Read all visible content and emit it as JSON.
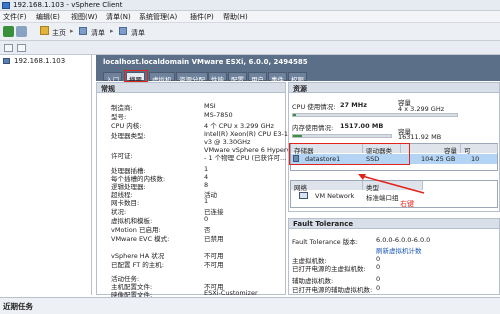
{
  "window": {
    "title": "192.168.1.103 - vSphere Client"
  },
  "menu": [
    "文件(F)",
    "编辑(E)",
    "视图(W)",
    "清单(N)",
    "系统管理(A)",
    "插件(P)",
    "帮助(H)"
  ],
  "nav": {
    "home": "主页",
    "inventory1": "清单",
    "inventory2": "清单"
  },
  "tree": {
    "host": "192.168.1.103"
  },
  "host": {
    "title": "localhost.localdomain VMware ESXi, 6.0.0, 2494585"
  },
  "tabs": [
    "入门",
    "摘要",
    "虚拟机",
    "资源分配",
    "性能",
    "配置",
    "用户",
    "事件",
    "权限"
  ],
  "general": {
    "header": "常规",
    "rows": [
      {
        "label": "制造商:",
        "value": "MSI"
      },
      {
        "label": "型号:",
        "value": "MS-7850"
      },
      {
        "label": "CPU 内核:",
        "value": "4 个 CPU x 3.299 GHz"
      },
      {
        "label": "处理器类型:",
        "value": "Intel(R) Xeon(R) CPU E3-1230\nv3 @ 3.30GHz"
      },
      {
        "label": "许可证:",
        "value": "VMware vSphere 6 Hypervisor\n- 1 个物理 CPU (已获许可..."
      },
      {
        "label": "处理器插槽:",
        "value": "1"
      },
      {
        "label": "每个插槽的内核数:",
        "value": "4"
      },
      {
        "label": "逻辑处理器:",
        "value": "8"
      },
      {
        "label": "超线程:",
        "value": "活动"
      },
      {
        "label": "网卡数目:",
        "value": "1"
      },
      {
        "label": "状况:",
        "value": "已连接"
      },
      {
        "label": "虚拟机和模板:",
        "value": "0"
      },
      {
        "label": "vMotion 已启用:",
        "value": "否"
      },
      {
        "label": "VMware EVC 模式:",
        "value": "已禁用"
      },
      {
        "label": "vSphere HA 状况",
        "value": "不可用"
      },
      {
        "label": "已配置 FT 的主机:",
        "value": "不可用"
      },
      {
        "label": "活动任务:",
        "value": ""
      },
      {
        "label": "主机配置文件:",
        "value": "不可用"
      },
      {
        "label": "映像配置文件:",
        "value": "ESXi-Customizer"
      }
    ]
  },
  "resources": {
    "header": "资源",
    "cpu_label": "CPU 使用情况:",
    "cpu_value": "27 MHz",
    "cpu_cap_label": "容量",
    "cpu_cap": "4 x 3.299 GHz",
    "cpu_usage_fraction": 0.02,
    "mem_label": "内存使用情况:",
    "mem_value": "1517.00 MB",
    "mem_cap_label": "容量",
    "mem_cap": "16311.92 MB",
    "mem_usage_fraction": 0.09,
    "storage_headers": [
      "存储器",
      "驱动器类型",
      "容量",
      "可"
    ],
    "storage_rows": [
      {
        "name": "datastore1",
        "type": "SSD",
        "capacity": "104.25 GB",
        "free": "10"
      }
    ],
    "network_headers": [
      "网络",
      "类型"
    ],
    "network_rows": [
      {
        "name": "VM Network",
        "type": "标准端口组"
      }
    ],
    "annotation": "右键"
  },
  "ft": {
    "header": "Fault Tolerance",
    "version_label": "Fault Tolerance 版本:",
    "version_value": "6.0.0-6.0.0-6.0.0",
    "refresh": "刷新虚拟机计数",
    "rows": [
      {
        "label": "主虚拟机数:",
        "value": "0"
      },
      {
        "label": "已打开电源的主虚拟机数:",
        "value": "0"
      },
      {
        "label": "辅助虚拟机数:",
        "value": "0"
      },
      {
        "label": "已打开电源的辅助虚拟机数:",
        "value": "0"
      }
    ]
  },
  "statusbar": {
    "label": "近期任务"
  },
  "colors": {
    "accent": "#e2231a",
    "header": "#5b6f88"
  }
}
